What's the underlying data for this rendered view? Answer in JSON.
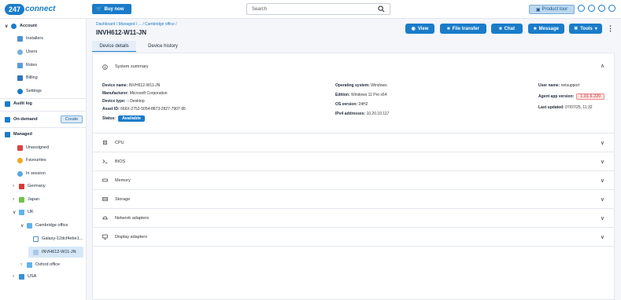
{
  "topbar": {
    "logo_num": "247",
    "logo_word": "connect",
    "buy_now": "Buy now",
    "search_placeholder": "Search",
    "product_tour": "Product tour"
  },
  "sidebar": {
    "account": "Account",
    "installers": "Installers",
    "users": "Users",
    "roles": "Roles",
    "billing": "Billing",
    "settings": "Settings",
    "audit_log": "Audit log",
    "on_demand": "On-demand",
    "create": "Create",
    "managed": "Managed",
    "unassigned": "Unassigned",
    "favourites": "Favourites",
    "in_session": "In session",
    "germany": "Germany",
    "japan": "Japan",
    "uk": "UK",
    "cambridge_office": "Cambridge office",
    "galaxy": "Galaxy-12dcf4ebe1...",
    "invh": "INVH612-W11-JN",
    "oxford_office": "Oxford office",
    "usa": "USA"
  },
  "header": {
    "breadcrumb": "Dashboard / Managed / ... / Cambridge office /",
    "device_title": "INVH612-W11-JN",
    "view": "View",
    "file_transfer": "File transfer",
    "chat": "Chat",
    "message": "Message",
    "tools": "Tools"
  },
  "tabs": {
    "device_details": "Device details",
    "device_history": "Device history"
  },
  "summary": {
    "title": "System summary",
    "device_name_k": "Device name:",
    "device_name_v": "INVH612-W11-JN",
    "manufacturer_k": "Manufacturer:",
    "manufacturer_v": "Microsoft Corporation",
    "device_type_k": "Device type:",
    "device_type_v": "Desktop",
    "asset_id_k": "Asset ID:",
    "asset_id_v": "666X-2752-5054-8873-2827-7907-95",
    "status_k": "Status:",
    "status_v": "Available",
    "os_k": "Operating system:",
    "os_v": "Windows",
    "edition_k": "Edition:",
    "edition_v": "Windows 11 Pro x64",
    "os_version_k": "OS version:",
    "os_version_v": "24H2",
    "ipv4_k": "IPv4 addresses:",
    "ipv4_v": "10.20.10.117",
    "user_k": "User name:",
    "user_v": "netsupport",
    "agent_k": "Agent app version:",
    "agent_v": "1.01.6.220",
    "updated_k": "Last updated:",
    "updated_v": "07/07/25, 11:32"
  },
  "sections": {
    "cpu": "CPU",
    "bios": "BIOS",
    "memory": "Memory",
    "storage": "Storage",
    "network": "Network adapters",
    "display": "Display adapters"
  },
  "colors": {
    "brand": "#1a7cc9",
    "warning": "#c42a2a"
  }
}
